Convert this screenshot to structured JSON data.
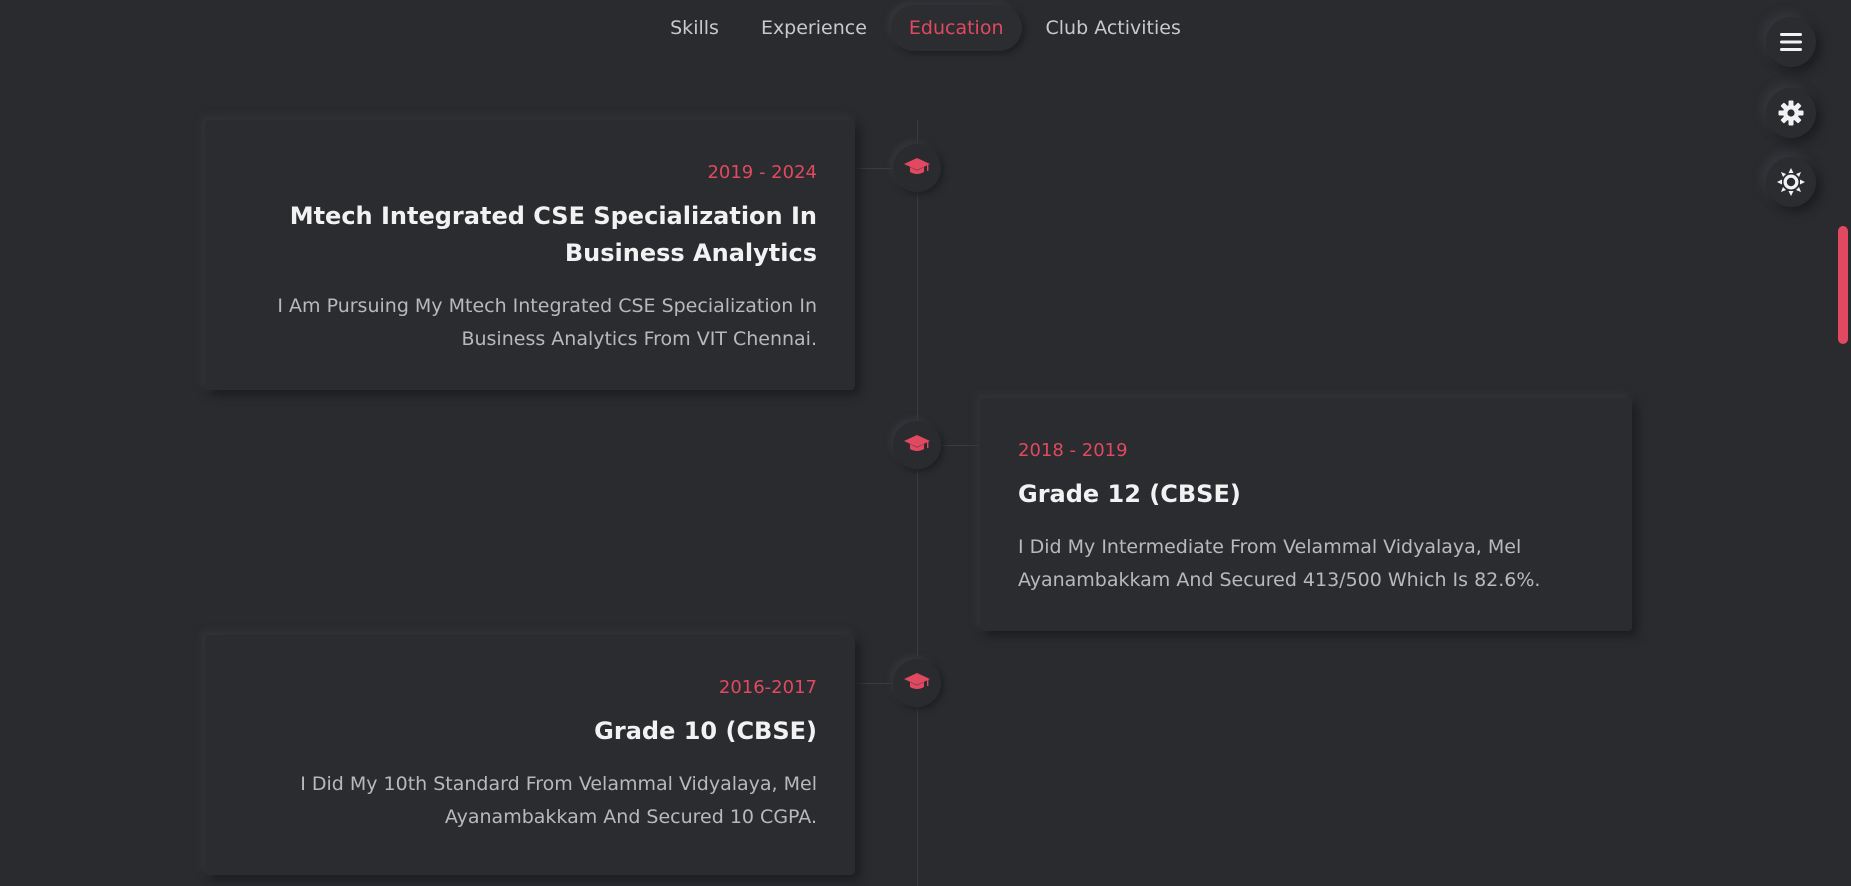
{
  "nav": {
    "tabs": [
      {
        "label": "Skills",
        "active": false
      },
      {
        "label": "Experience",
        "active": false
      },
      {
        "label": "Education",
        "active": true
      },
      {
        "label": "Club Activities",
        "active": false
      }
    ]
  },
  "controls": {
    "menu_icon": "hamburger-menu-icon",
    "settings_icon": "gear-icon",
    "theme_icon": "sun-icon"
  },
  "colors": {
    "accent": "#e0495f",
    "background": "#2a2b2f",
    "card": "#2b2c30"
  },
  "education": [
    {
      "years": "2019 - 2024",
      "title": "Mtech Integrated CSE Specialization In Business Analytics",
      "description": "I Am Pursuing My Mtech Integrated CSE Specialization In Business Analytics From VIT Chennai.",
      "icon": "graduation-cap-icon"
    },
    {
      "years": "2018 - 2019",
      "title": "Grade 12 (CBSE)",
      "description": "I Did My Intermediate From Velammal Vidyalaya, Mel Ayanambakkam And Secured 413/500 Which Is 82.6%.",
      "icon": "graduation-cap-icon"
    },
    {
      "years": "2016-2017",
      "title": "Grade 10 (CBSE)",
      "description": "I Did My 10th Standard From Velammal Vidyalaya, Mel Ayanambakkam And Secured 10 CGPA.",
      "icon": "graduation-cap-icon"
    }
  ]
}
